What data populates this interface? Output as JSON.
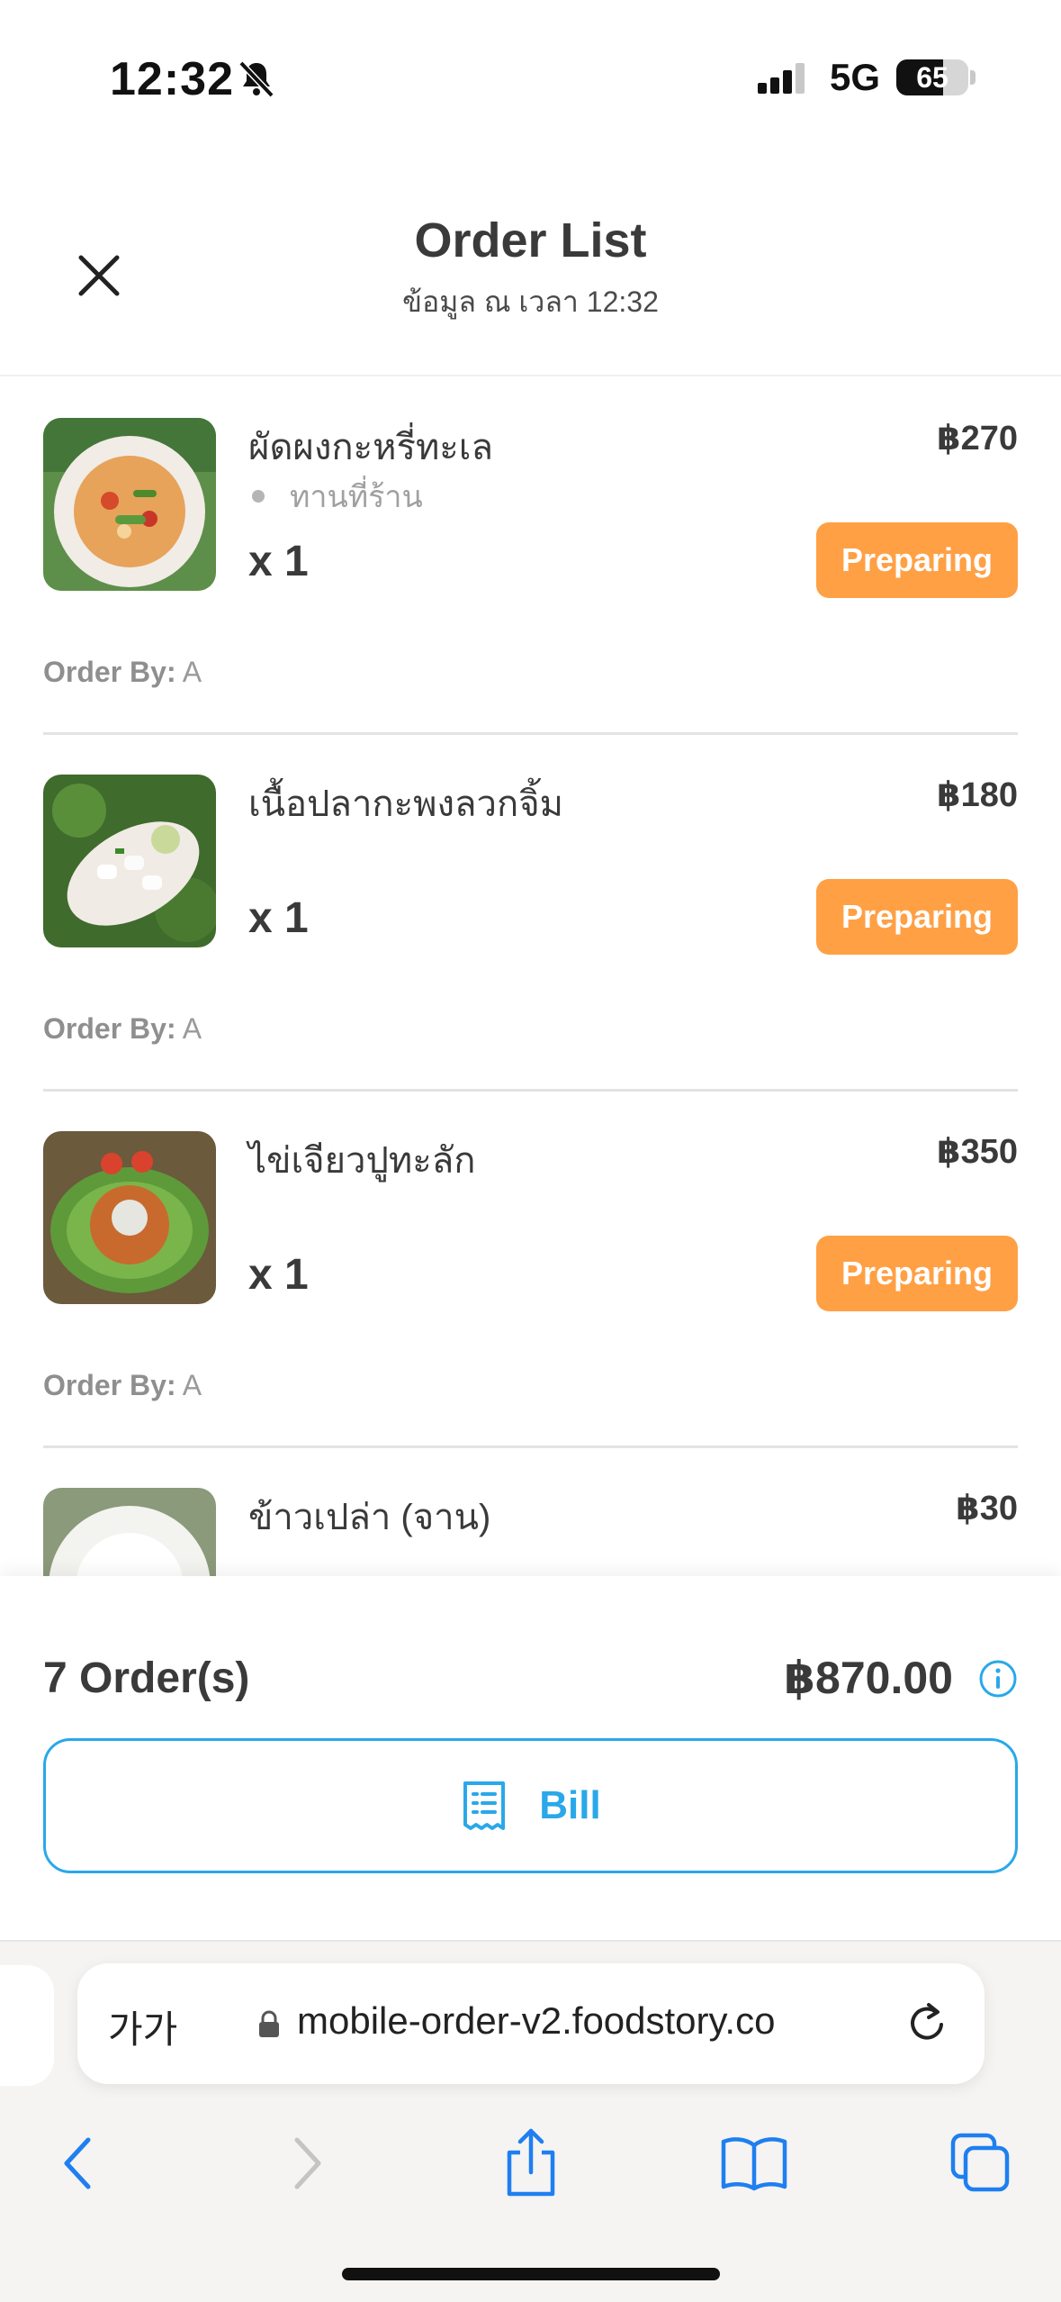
{
  "status_bar": {
    "time": "12:32",
    "network": "5G",
    "battery": "65",
    "battery_level": 0.65
  },
  "header": {
    "title": "Order List",
    "subtitle": "ข้อมูล ณ เวลา 12:32"
  },
  "orders": [
    {
      "name": "ผัดผงกะหรี่ทะเล",
      "price": "฿270",
      "note": "ทานที่ร้าน",
      "qty": "x 1",
      "status": "Preparing",
      "order_by_label": "Order By:",
      "order_by": "A"
    },
    {
      "name": "เนื้อปลากะพงลวกจิ้ม",
      "price": "฿180",
      "qty": "x 1",
      "status": "Preparing",
      "order_by_label": "Order By:",
      "order_by": "A"
    },
    {
      "name": "ไข่เจียวปูทะลัก",
      "price": "฿350",
      "qty": "x 1",
      "status": "Preparing",
      "order_by_label": "Order By:",
      "order_by": "A"
    },
    {
      "name": "ข้าวเปล่า (จาน)",
      "price": "฿30"
    }
  ],
  "summary": {
    "count": "7 Order(s)",
    "total": "฿870.00",
    "bill_label": "Bill"
  },
  "browser": {
    "aa_label": "가가",
    "url": "mobile-order-v2.foodstory.co"
  },
  "colors": {
    "accent": "#2aa8e9",
    "status_preparing": "#ffa045"
  }
}
